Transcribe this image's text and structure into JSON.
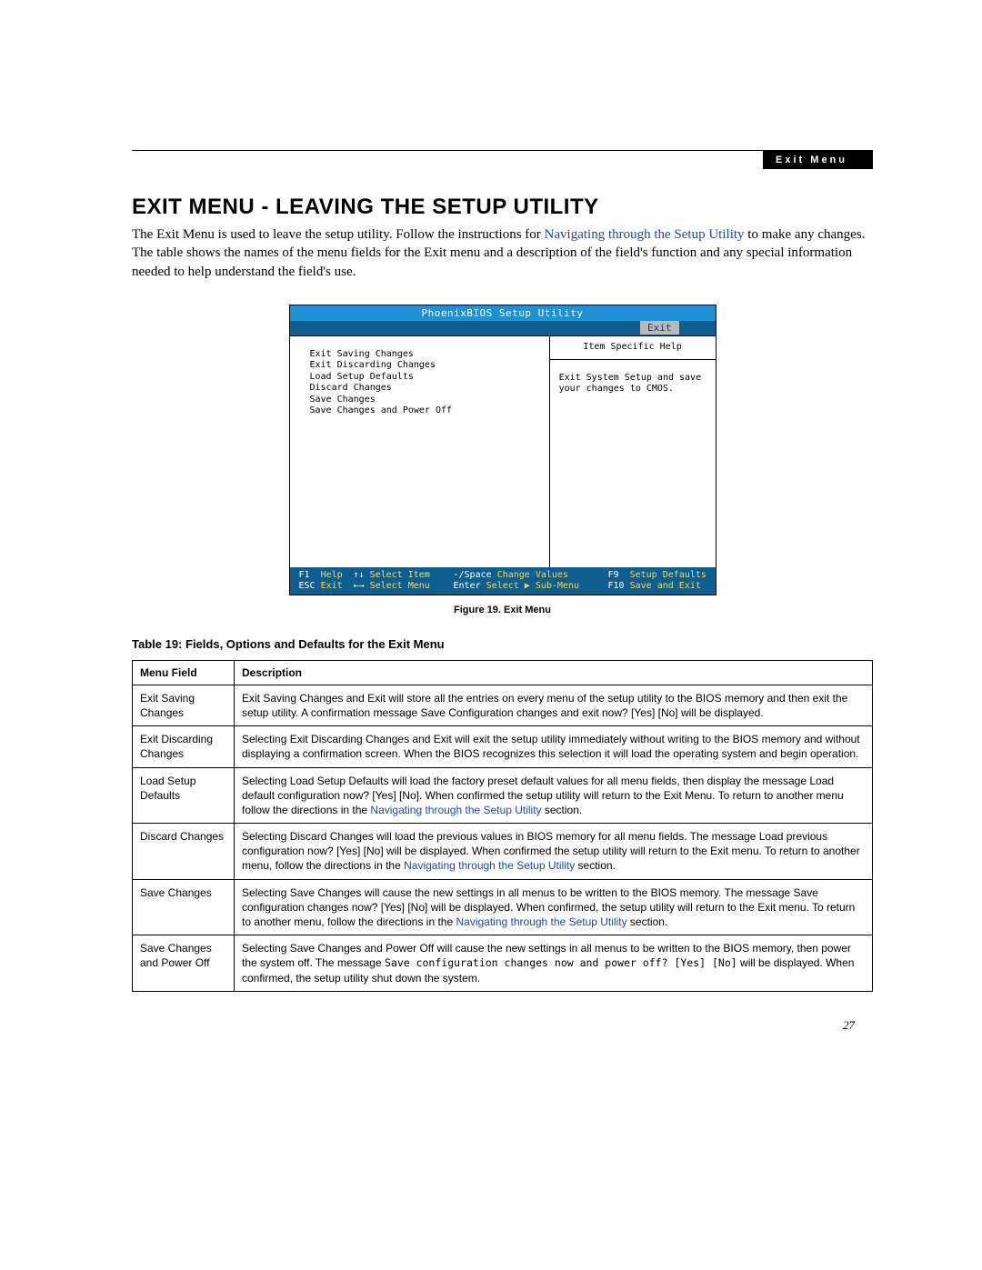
{
  "header_tab": "Exit Menu",
  "section_title": "EXIT MENU - LEAVING THE SETUP UTILITY",
  "intro_before_link": "The Exit Menu is used to leave the setup utility. Follow the instructions for ",
  "intro_link": "Navigating through the Setup Utility",
  "intro_after_link": " to make any changes. The table shows the names of the menu fields for the Exit menu and a description of the field's function and any special information needed to help understand the field's use.",
  "bios": {
    "title": "PhoenixBIOS Setup Utility",
    "tab": "Exit",
    "menu_items": [
      "Exit Saving Changes",
      "Exit Discarding Changes",
      "Load Setup Defaults",
      "Discard Changes",
      "Save Changes",
      "Save Changes and Power Off"
    ],
    "help_title": "Item Specific Help",
    "help_body": "Exit System Setup and save your changes to CMOS.",
    "foot": {
      "r1c1k": "F1",
      "r1c1v": "Help",
      "r1c2k": "↑↓",
      "r1c2v": "Select Item",
      "r1c3k": "-/Space",
      "r1c3v": "Change Values",
      "r1c4k": "F9",
      "r1c4v": "Setup Defaults",
      "r2c1k": "ESC",
      "r2c1v": "Exit",
      "r2c2k": "←→",
      "r2c2v": "Select Menu",
      "r2c3k": "Enter",
      "r2c3v": "Select ▶ Sub-Menu",
      "r2c4k": "F10",
      "r2c4v": "Save and Exit"
    }
  },
  "figure_caption": "Figure 19.  Exit Menu",
  "table_title": "Table 19: Fields, Options and Defaults for the Exit Menu",
  "columns": {
    "field": "Menu Field",
    "desc": "Description"
  },
  "nav_link_text": "Navigating through the Setup Utility",
  "rows": [
    {
      "field": "Exit Saving Changes",
      "desc": "Exit Saving Changes and Exit will store all the entries on every menu of the setup utility to the BIOS memory and then exit the setup utility. A confirmation message Save Configuration changes and exit now? [Yes] [No] will be displayed."
    },
    {
      "field": "Exit Discarding Changes",
      "desc": "Selecting Exit Discarding Changes and Exit will exit the setup utility immediately without writing to the BIOS memory and without displaying a confirmation screen. When the BIOS recognizes this selection it will load the operating system and begin operation."
    },
    {
      "field": "Load Setup Defaults",
      "desc_before": "Selecting Load Setup Defaults will load the factory preset default values for all menu fields, then display the message Load default configuration now? [Yes] [No]. When confirmed the setup utility will return to the Exit Menu. To return to another menu follow the directions in the ",
      "desc_after": " section."
    },
    {
      "field": "Discard Changes",
      "desc_before": "Selecting Discard Changes will load the previous values in BIOS memory for all menu fields. The message Load previous configuration now? [Yes] [No] will be displayed. When confirmed the setup utility will return to the Exit menu. To return to another menu, follow the directions in the ",
      "desc_after": " section."
    },
    {
      "field": "Save Changes",
      "desc_before": "Selecting Save Changes will cause the new settings in all menus to be written to the BIOS memory. The message Save configuration changes now? [Yes] [No] will be displayed. When confirmed, the setup utility will return to the Exit menu. To return to another menu, follow the directions in the ",
      "desc_after": " section."
    },
    {
      "field": "Save Changes and Power Off",
      "desc_before": "Selecting Save Changes and Power Off will cause the new settings in all menus to be written to the BIOS memory, then power the system off. The message ",
      "mono": "Save configuration changes now and power off? [Yes] [No]",
      "desc_after": " will be displayed. When confirmed, the setup utility shut down the system."
    }
  ],
  "page_number": "27"
}
